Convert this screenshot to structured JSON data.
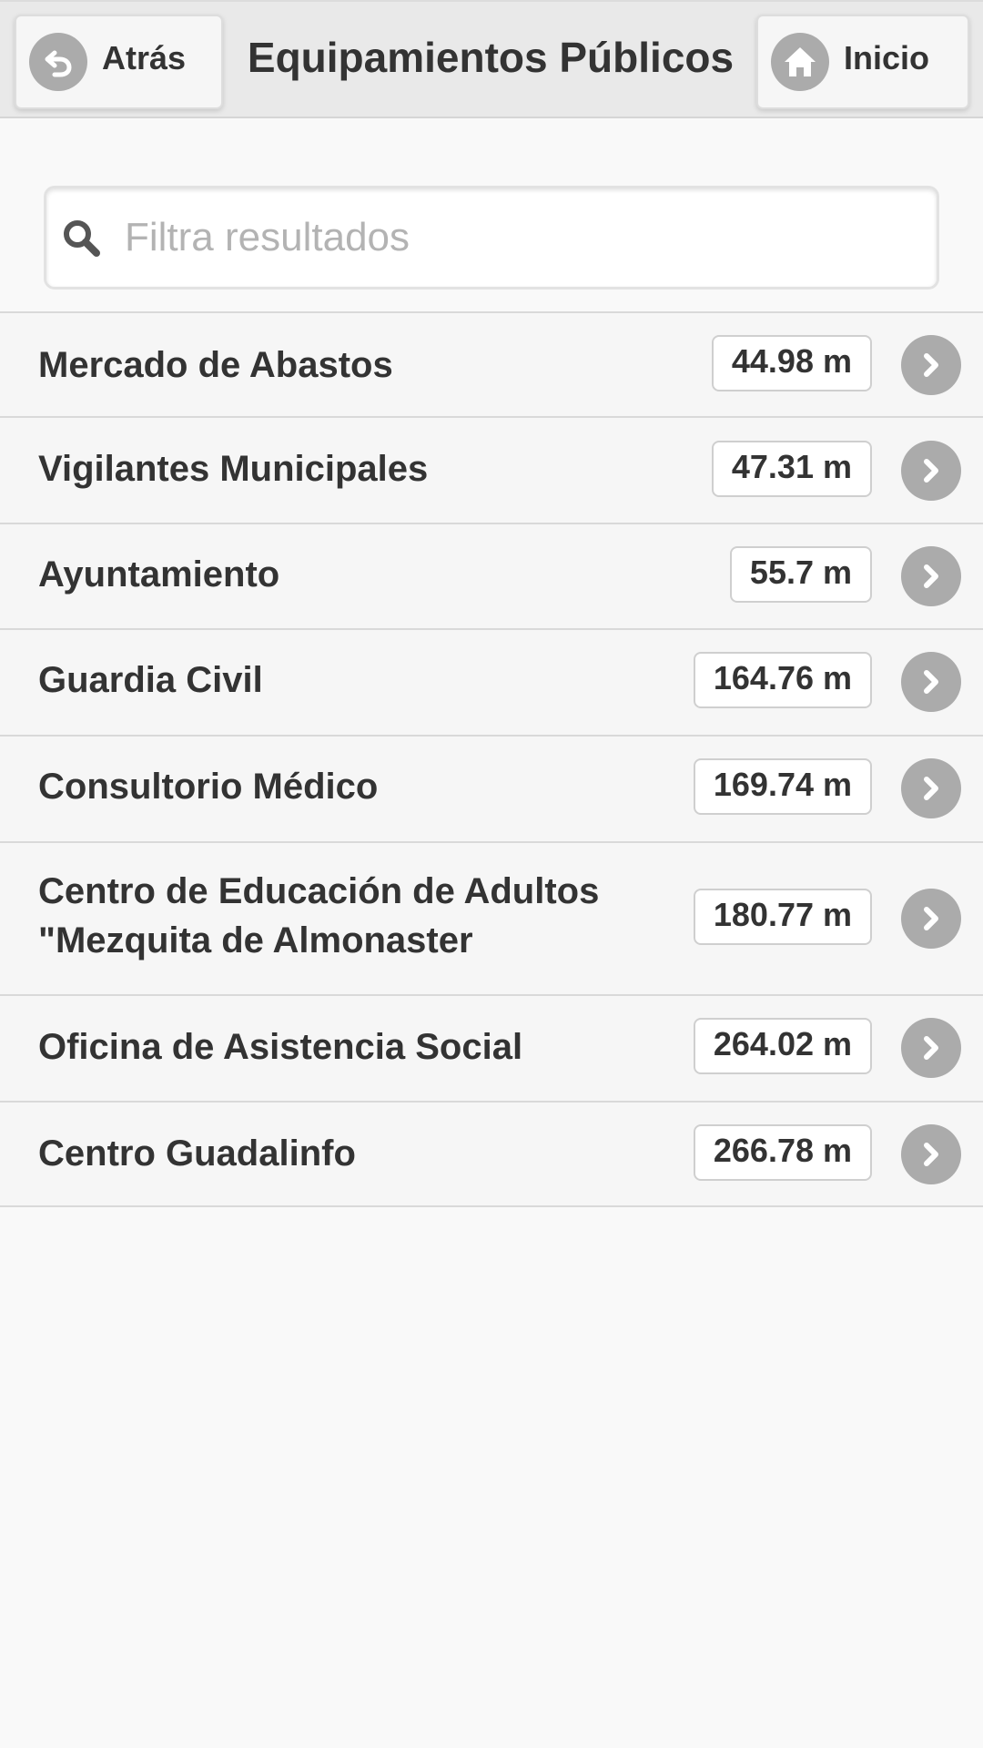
{
  "header": {
    "back_label": "Atrás",
    "title": "Equipamientos Públicos",
    "home_label": "Inicio"
  },
  "search": {
    "placeholder": "Filtra resultados",
    "value": ""
  },
  "items": [
    {
      "name": "Mercado de Abastos",
      "distance": "44.98 m"
    },
    {
      "name": "Vigilantes Municipales",
      "distance": "47.31 m"
    },
    {
      "name": "Ayuntamiento",
      "distance": "55.7 m"
    },
    {
      "name": "Guardia Civil",
      "distance": "164.76 m"
    },
    {
      "name": "Consultorio Médico",
      "distance": "169.74 m"
    },
    {
      "name": "Centro de Educación de Adultos \"Mezquita de Almonaster",
      "distance": "180.77 m"
    },
    {
      "name": "Oficina de Asistencia Social",
      "distance": "264.02 m"
    },
    {
      "name": "Centro Guadalinfo",
      "distance": "266.78 m"
    }
  ],
  "colors": {
    "header_bg": "#e9e9e9",
    "page_bg": "#f9f9f9",
    "icon_gray": "#ababab",
    "text": "#333333"
  }
}
